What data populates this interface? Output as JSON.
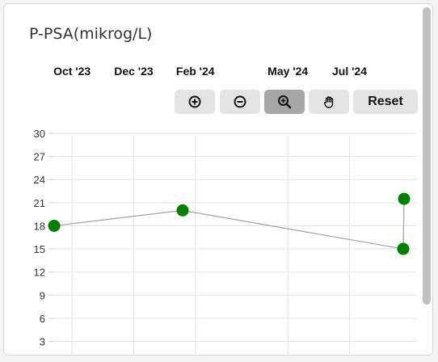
{
  "title": "P-PSA(mikrog/L)",
  "toolbar": {
    "zoom_in_icon": "zoom-in-icon",
    "zoom_out_icon": "zoom-out-icon",
    "zoom_select_icon": "magnifier-plus-icon",
    "pan_icon": "hand-icon",
    "reset_label": "Reset"
  },
  "chart_data": {
    "type": "line",
    "title": "P-PSA(mikrog/L)",
    "x_tick_labels": [
      "Oct '23",
      "Dec '23",
      "Feb '24",
      "May '24",
      "Jul '24"
    ],
    "y_ticks": [
      3,
      6,
      9,
      12,
      15,
      18,
      21,
      24,
      27,
      30
    ],
    "ylim": [
      3,
      30
    ],
    "grid": true,
    "series": [
      {
        "color": "#008000",
        "points": [
          {
            "x": "2023-09",
            "y": 18
          },
          {
            "x": "2024-01",
            "y": 20
          },
          {
            "x": "2024-08",
            "y": 15
          },
          {
            "x": "2024-08",
            "y": 21.5
          }
        ]
      }
    ]
  }
}
